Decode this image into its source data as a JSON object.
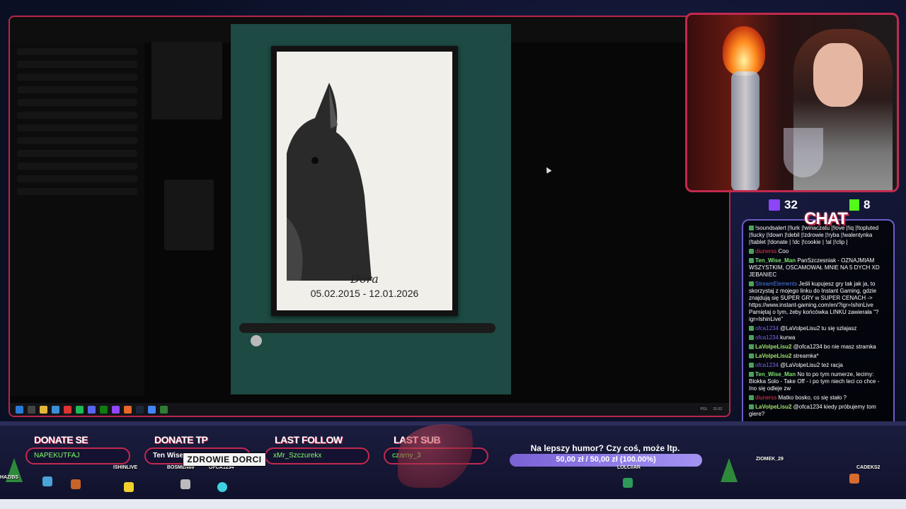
{
  "screen": {
    "artwork": {
      "name": "Dora",
      "dates": "05.02.2015 - 12.01.2026"
    },
    "taskbar": {
      "tray_lang": "POL",
      "time": "21:02"
    }
  },
  "counters": {
    "twitch_viewers": "32",
    "kick_viewers": "8"
  },
  "chat": {
    "title": "CHAT",
    "messages": [
      {
        "user": "",
        "text": "!soundsalert |!lurk |!winaczatu |!love |!iq |!topluted |!lucky |!down |!debil |!zdrowie |!ryba |!walentynka |!tablet |!donate | !dc |!cookie | !al |!clip |",
        "user_color": "u-purple"
      },
      {
        "user": "diunerss",
        "text": "Coo",
        "user_color": "u-red"
      },
      {
        "user": "Ten_Wise_Man",
        "text": "PanSzczesniak - OZNAJMIAM WSZYSTKIM, OSCAMOWAŁ MNIE NA 5 DYCH XD JEBANIEC",
        "user_color": "u-green"
      },
      {
        "user": "StreamElements",
        "text": "Jeśli kupujesz gry tak jak ja, to skorzystaj z mojego linku do Instant Gaming, gdzie znajdują się SUPER GRY w SUPER CENACH -> https://www.instant-gaming.com/en/?igr=IshinLive Pamiętaj o tym, żeby końcówka LINKU zawierała \"?igr=IshinLive\"",
        "user_color": "u-blue"
      },
      {
        "user": "ofca1234",
        "text": "@LaVolpeLisu2 tu się szlajasz",
        "user_color": "u-purple"
      },
      {
        "user": "ofca1234",
        "text": "kurwa",
        "user_color": "u-purple"
      },
      {
        "user": "LaVolpeLisu2",
        "text": "@ofca1234 bo nie masz stramka",
        "user_color": "u-lime"
      },
      {
        "user": "LaVolpeLisu2",
        "text": "streamka*",
        "user_color": "u-lime"
      },
      {
        "user": "ofca1234",
        "text": "@LaVolpeLisu2 też racja",
        "user_color": "u-purple"
      },
      {
        "user": "Ten_Wise_Man",
        "text": "No to po tym numerze, lecimy: Blokka Solo - Take Off - i po tym niech leci co chce - Ino się odleje zw",
        "user_color": "u-green"
      },
      {
        "user": "diunerss",
        "text": "Matko bosko, co się stało ?",
        "user_color": "u-red"
      },
      {
        "user": "LaVolpeLisu2",
        "text": "@ofca1234 kiedy próbujemy tom giere?",
        "user_color": "u-lime"
      }
    ]
  },
  "overlay": {
    "donate_se": {
      "label": "DONATE SE",
      "value": "NAPEKUTFAJ"
    },
    "donate_tp": {
      "label": "DONATE TP",
      "value": "Ten Wise"
    },
    "last_follow": {
      "label": "LAST FOLLOW",
      "value": "xMr_Szczurekx"
    },
    "last_sub": {
      "label": "LAST SUB",
      "value": "czarny_3"
    },
    "goal": {
      "title": "Na lepszy humor? Czy coś, może ltp.",
      "value": "50,00 zł / 50,00 zł (100.00%)",
      "progress": 1.0
    },
    "alert": "ZDROWIE DORCI",
    "viewer_names": [
      "HAZIBS",
      "ISHINLIVE",
      "BOSMEN69",
      "OFCA1234",
      "LOLCIIAR",
      "ZIOMEK_29",
      "CADEKS2"
    ]
  }
}
